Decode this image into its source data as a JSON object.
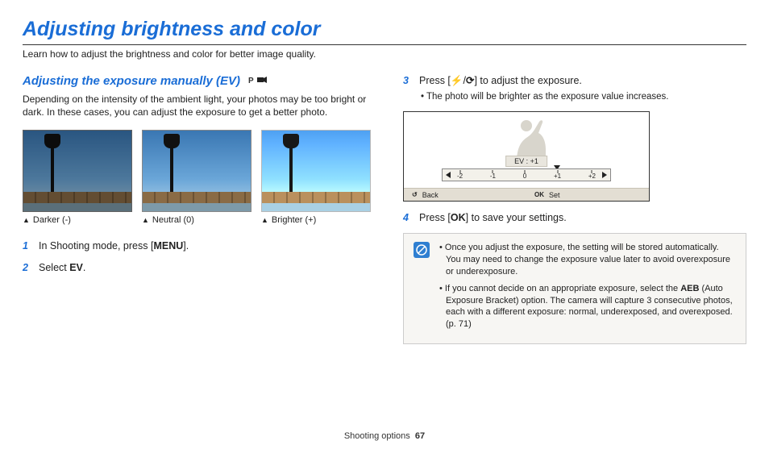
{
  "page": {
    "title": "Adjusting brightness and color",
    "subtitle": "Learn how to adjust the brightness and color for better image quality."
  },
  "left": {
    "heading": "Adjusting the exposure manually (EV)",
    "mode_p": "P",
    "mode_movie": "■■",
    "body": "Depending on the intensity of the ambient light, your photos may be too bright or dark. In these cases, you can adjust the exposure to get a better photo.",
    "captions": {
      "darker": "Darker (-)",
      "neutral": "Neutral (0)",
      "brighter": "Brighter (+)"
    },
    "steps": {
      "n1": "1",
      "t1a": "In Shooting mode, press [",
      "t1b": "MENU",
      "t1c": "].",
      "n2": "2",
      "t2a": "Select ",
      "t2b": "EV",
      "t2c": "."
    }
  },
  "right": {
    "steps": {
      "n3": "3",
      "t3a": "Press [",
      "t3b": "⚡",
      "t3sep": "/",
      "t3c": "⟳",
      "t3d": "] to adjust the exposure.",
      "t3sub": "•  The photo will be brighter as the exposure value increases.",
      "n4": "4",
      "t4a": "Press [",
      "t4b": "OK",
      "t4c": "] to save your settings."
    },
    "screen": {
      "ev_label": "EV : +1",
      "ticks": {
        "m2": "-2",
        "m1": "-1",
        "z": "0",
        "p1": "+1",
        "p2": "+2"
      },
      "back_key": "↺",
      "back_label": "Back",
      "set_key": "OK",
      "set_label": "Set"
    },
    "note": {
      "icon": "⊘",
      "b1a": "•  Once you adjust the exposure, the setting will be stored automatically. You may need to change the exposure value later to avoid overexposure or underexposure.",
      "b2a": "•  If you cannot decide on an appropriate exposure, select the ",
      "b2b": "AEB",
      "b2c": " (Auto Exposure Bracket) option. The camera will capture 3 consecutive photos, each with a different exposure: normal, underexposed, and overexposed. (p. 71)"
    }
  },
  "footer": {
    "section": "Shooting options",
    "page_number": "67"
  }
}
